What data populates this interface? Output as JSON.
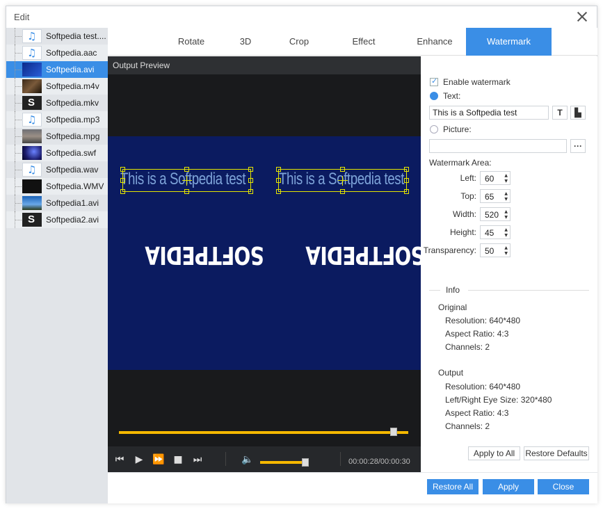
{
  "window": {
    "title": "Edit"
  },
  "files": [
    {
      "name": "Softpedia test....",
      "thumb": "audio"
    },
    {
      "name": "Softpedia.aac",
      "thumb": "audio"
    },
    {
      "name": "Softpedia.avi",
      "thumb": "blue",
      "selected": true
    },
    {
      "name": "Softpedia.m4v",
      "thumb": "m4v"
    },
    {
      "name": "Softpedia.mkv",
      "thumb": "bw"
    },
    {
      "name": "Softpedia.mp3",
      "thumb": "audio"
    },
    {
      "name": "Softpedia.mpg",
      "thumb": "mpg"
    },
    {
      "name": "Softpedia.swf",
      "thumb": "swf"
    },
    {
      "name": "Softpedia.wav",
      "thumb": "audio"
    },
    {
      "name": "Softpedia.WMV",
      "thumb": "black"
    },
    {
      "name": "Softpedia1.avi",
      "thumb": "sky"
    },
    {
      "name": "Softpedia2.avi",
      "thumb": "bw"
    }
  ],
  "tabs": [
    "Rotate",
    "3D",
    "Crop",
    "Effect",
    "Enhance",
    "Watermark"
  ],
  "active_tab": "Watermark",
  "preview": {
    "title": "Output Preview",
    "watermark_text": "This is a Softpedia test",
    "logo_text": "SOFTPEDIA",
    "time": "00:00:28/00:00:30",
    "progress": 0.95,
    "volume": 0.93
  },
  "watermark": {
    "enable_label": "Enable watermark",
    "enabled": true,
    "text_label": "Text:",
    "text_value": "This is a Softpedia test",
    "text_font_icon": "T",
    "picture_label": "Picture:",
    "picture_value": "",
    "browse_label": "···",
    "area_label": "Watermark Area:",
    "left_label": "Left:",
    "left": "60",
    "top_label": "Top:",
    "top": "65",
    "width_label": "Width:",
    "width": "520",
    "height_label": "Height:",
    "height": "45",
    "transparency_label": "Transparency:",
    "transparency": "50"
  },
  "info": {
    "header": "Info",
    "original_label": "Original",
    "original_resolution": "Resolution: 640*480",
    "original_aspect": "Aspect Ratio: 4:3",
    "original_channels": "Channels: 2",
    "output_label": "Output",
    "output_resolution": "Resolution: 640*480",
    "output_eye": "Left/Right Eye Size: 320*480",
    "output_aspect": "Aspect Ratio: 4:3",
    "output_channels": "Channels: 2"
  },
  "buttons": {
    "apply_to_all": "Apply to All",
    "restore_defaults": "Restore Defaults",
    "restore_all": "Restore All",
    "apply": "Apply",
    "close": "Close"
  },
  "colors": {
    "accent": "#3a8ee6",
    "progress": "#f5b800",
    "video_bg": "#0b1b60",
    "handle": "#e6e600"
  }
}
